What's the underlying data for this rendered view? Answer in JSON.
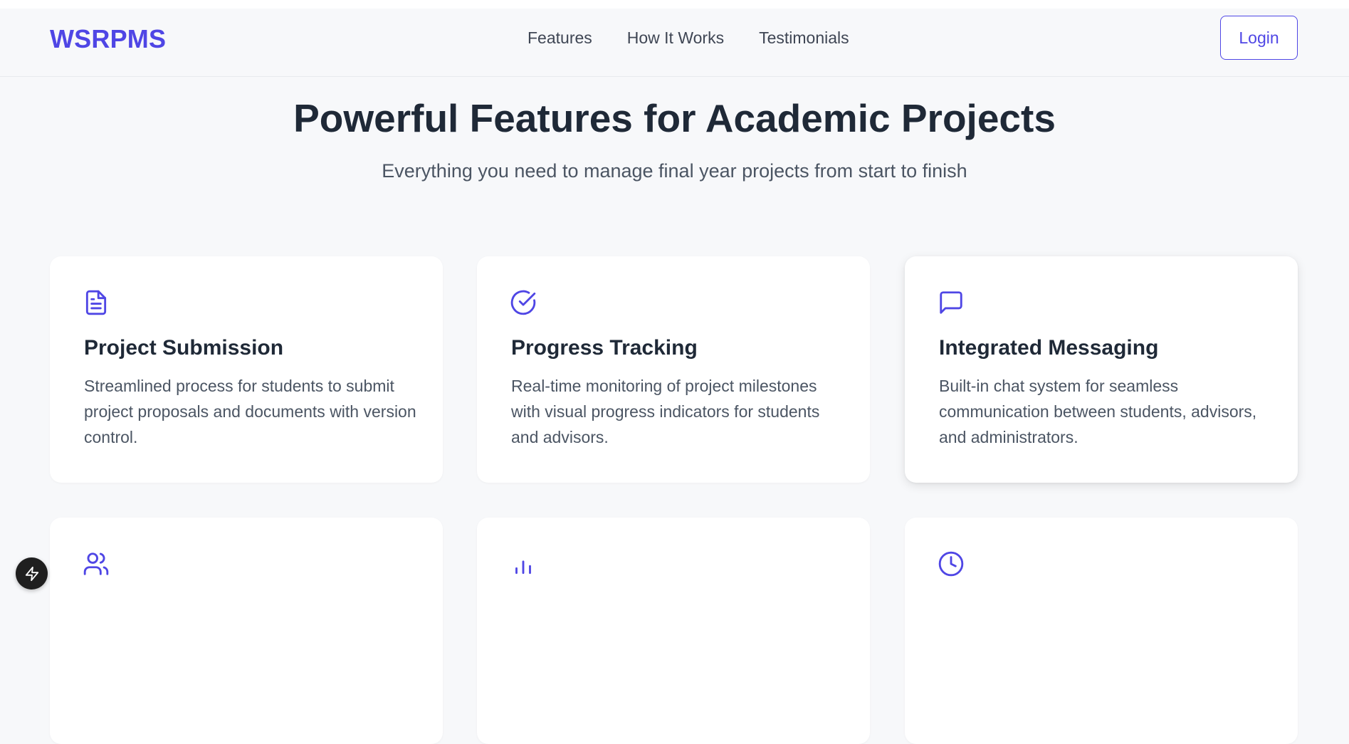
{
  "header": {
    "logo": "WSRPMS",
    "nav": [
      "Features",
      "How It Works",
      "Testimonials"
    ],
    "login_label": "Login"
  },
  "hero": {
    "title": "Powerful Features for Academic Projects",
    "subtitle": "Everything you need to manage final year projects from start to finish"
  },
  "features": [
    {
      "icon": "document-icon",
      "title": "Project Submission",
      "description": "Streamlined process for students to submit project proposals and documents with version control."
    },
    {
      "icon": "check-circle-icon",
      "title": "Progress Tracking",
      "description": "Real-time monitoring of project milestones with visual progress indicators for students and advisors."
    },
    {
      "icon": "message-icon",
      "title": "Integrated Messaging",
      "description": "Built-in chat system for seamless communication between students, advisors, and administrators."
    },
    {
      "icon": "users-icon",
      "title": "",
      "description": ""
    },
    {
      "icon": "bar-chart-icon",
      "title": "",
      "description": ""
    },
    {
      "icon": "clock-icon",
      "title": "",
      "description": ""
    }
  ],
  "colors": {
    "accent": "#4f46e5",
    "background": "#f7f8fa",
    "heading": "#1f2937",
    "body_text": "#4b5563"
  },
  "floating_button": {
    "icon": "bolt-icon"
  }
}
